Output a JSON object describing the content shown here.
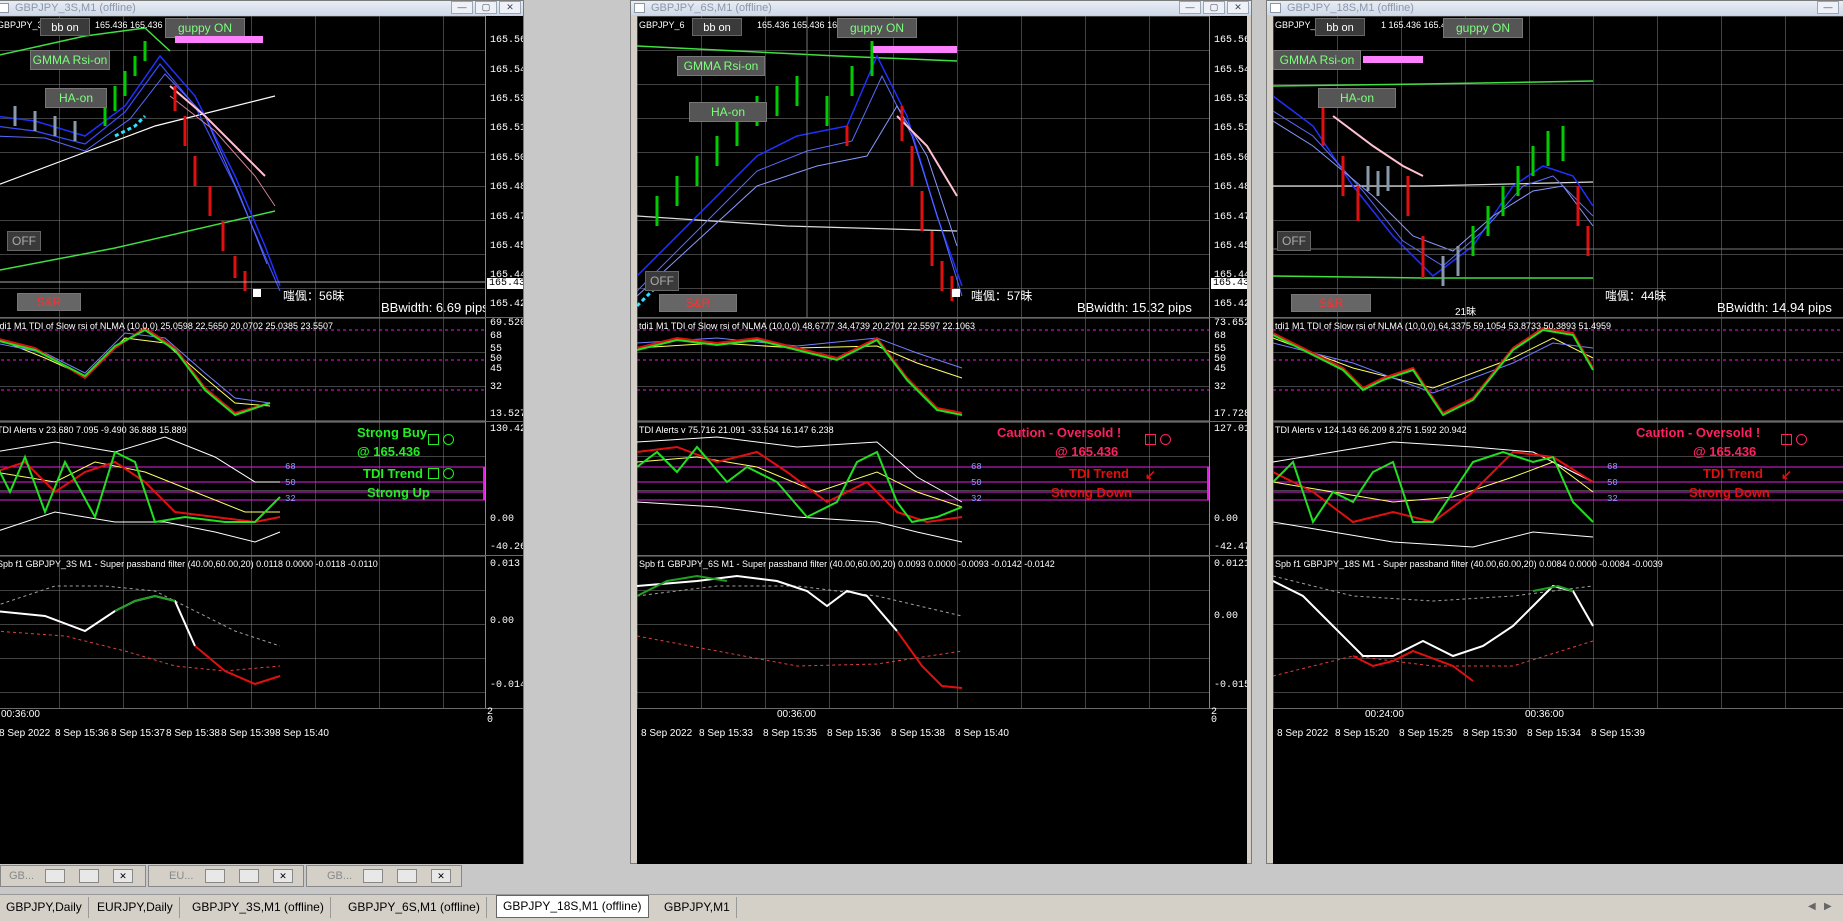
{
  "windows": [
    {
      "title": "GBPJPY_3S,M1 (offline)",
      "top_info": "GBPJPY_3",
      "quote": "165.436 165.436 165",
      "price_ticks": [
        "165.560",
        "165.545",
        "165.530",
        "165.515",
        "165.500",
        "165.485",
        "165.470",
        "165.455",
        "165.440",
        "165.425"
      ],
      "current_price": "165.436",
      "bbwidth": "BBwidth: 6.69 pips",
      "kanji": "嗤偑：56昧",
      "tdi_label": "tdi1 M1 TDI of Slow rsi of NLMA (10,0,0) 25.0598 22.5650 20.0702 25.0385 23.5507",
      "tdi_ticks": [
        "68",
        "55",
        "50",
        "45",
        "32",
        "13.5278"
      ],
      "tdi_top": "69.5204",
      "alerts_label": "TDI Alerts v 23.680 7.095 -9.490 36.888 15.889",
      "alerts_ticks": [
        "130.426",
        "0.00",
        "-40.269"
      ],
      "alert1": "Strong Buy",
      "alert2": "@ 165.436",
      "alert3": "TDI Trend",
      "alert4": "Strong Up",
      "spb_label": "Spb f1 GBPJPY_3S M1 - Super passband filter (40.00,60.00,20) 0.0118 0.0000 -0.0118 -0.0110",
      "spb_ticks": [
        "0.013",
        "0.00",
        "-0.0146"
      ],
      "times": [
        "8 Sep 2022",
        "8 Sep 15:36",
        "8 Sep 15:37",
        "8 Sep 15:38",
        "8 Sep 15:39",
        "8 Sep 15:40"
      ],
      "time_mid": "00:36:00",
      "bottom_ticks": [
        "2",
        "0"
      ]
    },
    {
      "title": "GBPJPY_6S,M1 (offline)",
      "top_info": "GBPJPY_6",
      "quote": "165.436 165.436 165",
      "price_ticks": [
        "165.560",
        "165.545",
        "165.530",
        "165.515",
        "165.500",
        "165.485",
        "165.470",
        "165.455",
        "165.440",
        "165.425"
      ],
      "current_price": "165.436",
      "bbwidth": "BBwidth: 15.32 pips",
      "kanji": "嗤偑：57昧",
      "tdi_label": "tdi1 M1 TDI of Slow rsi of NLMA (10,0,0) 48.6777 34.4739 20.2701 22.5597 22.1063",
      "tdi_ticks": [
        "68",
        "55",
        "50",
        "45",
        "32",
        "17.728"
      ],
      "tdi_top": "73.6527",
      "alerts_label": "TDI Alerts v 75.716 21.091 -33.534 16.147 6.238",
      "alerts_ticks": [
        "127.014",
        "0.00",
        "-42.472"
      ],
      "alert1": "Caution - Oversold !",
      "alert2": "@ 165.436",
      "alert3": "TDI Trend",
      "alert4": "Strong Down",
      "spb_label": "Spb f1 GBPJPY_6S M1 - Super passband filter (40.00,60.00,20) 0.0093 0.0000 -0.0093 -0.0142 -0.0142",
      "spb_ticks": [
        "0.0121",
        "0.00",
        "-0.0157"
      ],
      "times": [
        "8 Sep 2022",
        "8 Sep 15:33",
        "8 Sep 15:35",
        "8 Sep 15:36",
        "8 Sep 15:38",
        "8 Sep 15:40"
      ],
      "time_mid": "00:36:00",
      "bottom_ticks": [
        "2",
        "0"
      ]
    },
    {
      "title": "GBPJPY_18S,M1 (offline)",
      "top_info": "GBPJPY_1",
      "quote": "1 165.436 165.431 165",
      "price_ticks": [],
      "current_price": "",
      "bbwidth": "BBwidth: 14.94 pips",
      "kanji": "嗤偑：44昧",
      "kanji2": "21昧",
      "tdi_label": "tdi1 M1 TDI of Slow rsi of NLMA (10,0,0) 64.3375 59.1054 53.8733 50.3893 51.4959",
      "tdi_ticks": [],
      "tdi_top": "",
      "alerts_label": "TDI Alerts v 124.143 66.209 8.275 1.592 20.942",
      "alerts_ticks": [],
      "alert1": "Caution - Oversold !",
      "alert2": "@ 165.436",
      "alert3": "TDI Trend",
      "alert4": "Strong Down",
      "spb_label": "Spb f1 GBPJPY_18S M1 - Super passband filter (40.00,60.00,20) 0.0084 0.0000 -0.0084 -0.0039",
      "spb_ticks": [],
      "times": [
        "8 Sep 2022",
        "8 Sep 15:20",
        "8 Sep 15:25",
        "8 Sep 15:30",
        "8 Sep 15:34",
        "8 Sep 15:39"
      ],
      "time_mid": "00:24:00",
      "time_mid2": "00:36:00",
      "bottom_ticks": []
    }
  ],
  "buttons": {
    "bb": "bb on",
    "guppy": "guppy ON",
    "gmma": "GMMA Rsi-on",
    "ha": "HA-on",
    "off": "OFF",
    "sr": "S&R"
  },
  "tdi_levels": [
    "68",
    "50",
    "32"
  ],
  "minimized": [
    "GB...",
    "EU...",
    "GB..."
  ],
  "tabs": [
    "GBPJPY,Daily",
    "EURJPY,Daily",
    "GBPJPY_3S,M1 (offline)",
    "GBPJPY_6S,M1 (offline)",
    "GBPJPY_18S,M1 (offline)",
    "GBPJPY,M1"
  ],
  "colors": {
    "bg": "#000000",
    "bull": "#00cc00",
    "bear": "#e01010",
    "guppy": "#2030ff",
    "tdi_green": "#20e020",
    "tdi_red": "#e01010",
    "buy_alert": "#22ee22",
    "sell_alert": "#ff2060",
    "level": "#e020e0",
    "band_green": "#40e040"
  }
}
